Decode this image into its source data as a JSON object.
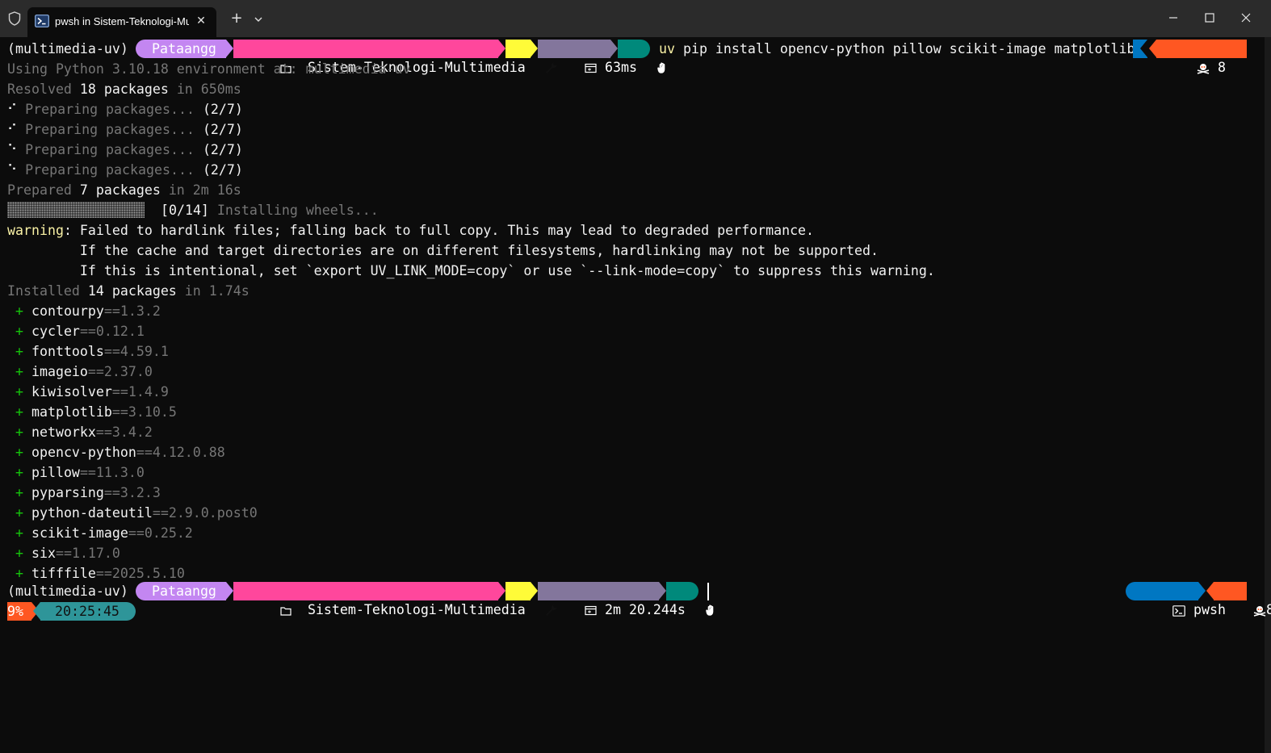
{
  "window": {
    "tab_title": "pwsh in Sistem-Teknologi-Mu",
    "tab_close_glyph": "✕",
    "new_tab_glyph": "+",
    "icons": [
      "shield-icon",
      "powershell-icon",
      "close-icon",
      "plus-icon",
      "chevron-down-icon",
      "minimize-icon",
      "maximize-icon",
      "close-window-icon"
    ]
  },
  "prompt1": {
    "venv": "(multimedia-uv)",
    "user": "Pataangg",
    "folder": "Sistem-Teknologi-Multimedia",
    "duration": "63ms",
    "command_tool": "uv",
    "command_args": " pip install opencv-python pillow scikit-image matplotlib",
    "errors": "8"
  },
  "output": {
    "using_python": "Using Python 3.10.18 environment at: multimedia-uv",
    "resolved_a": "Resolved ",
    "resolved_b": "18 packages",
    "resolved_c": " in 650ms",
    "preparing": [
      {
        "spinner": "⠊",
        "text": " Preparing packages... ",
        "count": "(2/7)"
      },
      {
        "spinner": "⠊",
        "text": " Preparing packages... ",
        "count": "(2/7)"
      },
      {
        "spinner": "⠑",
        "text": " Preparing packages... ",
        "count": "(2/7)"
      },
      {
        "spinner": "⠑",
        "text": " Preparing packages... ",
        "count": "(2/7)"
      }
    ],
    "prepared_a": "Prepared ",
    "prepared_b": "7 packages",
    "prepared_c": " in 2m 16s",
    "wheels_count": "[0/14]",
    "wheels_text": " Installing wheels...",
    "warning_label": "warning",
    "warning_text": ": Failed to hardlink files; falling back to full copy. This may lead to degraded performance.",
    "warning_line2": "         If the cache and target directories are on different filesystems, hardlinking may not be supported.",
    "warning_line3": "         If this is intentional, set `export UV_LINK_MODE=copy` or use `--link-mode=copy` to suppress this warning.",
    "installed_a": "Installed ",
    "installed_b": "14 packages",
    "installed_c": " in 1.74s",
    "packages": [
      {
        "name": "contourpy",
        "version": "==1.3.2"
      },
      {
        "name": "cycler",
        "version": "==0.12.1"
      },
      {
        "name": "fonttools",
        "version": "==4.59.1"
      },
      {
        "name": "imageio",
        "version": "==2.37.0"
      },
      {
        "name": "kiwisolver",
        "version": "==1.4.9"
      },
      {
        "name": "matplotlib",
        "version": "==3.10.5"
      },
      {
        "name": "networkx",
        "version": "==3.4.2"
      },
      {
        "name": "opencv-python",
        "version": "==4.12.0.88"
      },
      {
        "name": "pillow",
        "version": "==11.3.0"
      },
      {
        "name": "pyparsing",
        "version": "==3.2.3"
      },
      {
        "name": "python-dateutil",
        "version": "==2.9.0.post0"
      },
      {
        "name": "scikit-image",
        "version": "==0.25.2"
      },
      {
        "name": "six",
        "version": "==1.17.0"
      },
      {
        "name": "tifffile",
        "version": "==2025.5.10"
      }
    ]
  },
  "prompt2": {
    "venv": "(multimedia-uv)",
    "user": "Pataangg",
    "folder": "Sistem-Teknologi-Multimedia",
    "duration": "2m 20.244s",
    "shell": "pwsh",
    "errors": "8",
    "battery": "9%",
    "time": "20:25:45"
  },
  "colors": {
    "user_segment": "#c386f1",
    "folder_segment": "#ff479c",
    "git_segment": "#fffb38",
    "duration_segment": "#83769c",
    "status_segment": "#00897b",
    "error_segment": "#ff5722",
    "shell_segment": "#0077c2",
    "time_segment": "#2e9599",
    "terminal_bg": "#0c0c0c",
    "titlebar_bg": "#2b2b2b"
  }
}
